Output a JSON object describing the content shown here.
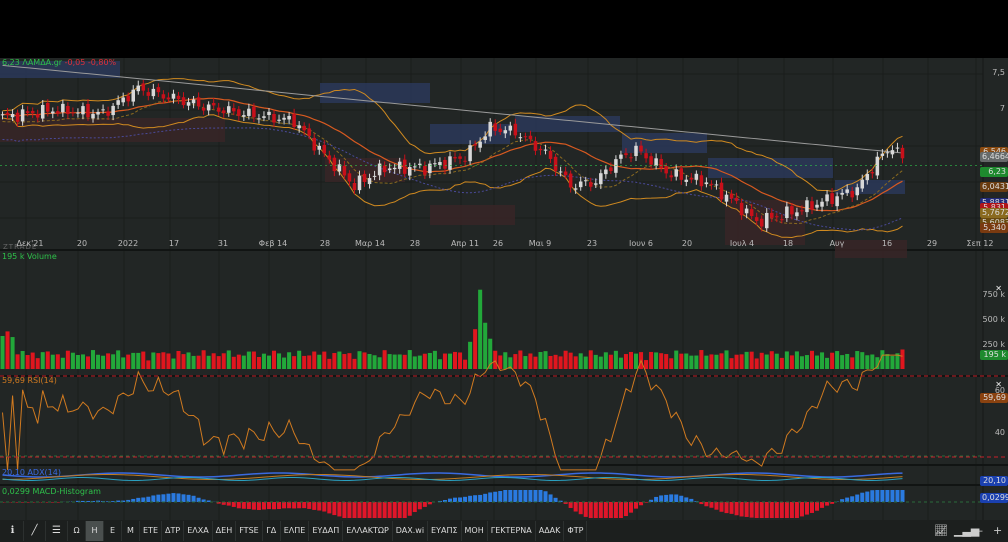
{
  "header": {
    "price": "6,23",
    "symbol": "ΛΑΜΔΑ.gr",
    "change": "-0,05",
    "change_pct": "-0,80%"
  },
  "watermark": "ZTRADE",
  "price_axis": {
    "ticks": [
      "7,5",
      "7"
    ],
    "tags": [
      {
        "value": "6,546",
        "color": "#8a4a10"
      },
      {
        "value": "6,4664",
        "color": "#666a6a"
      },
      {
        "value": "6,23",
        "color": "#1e8a2e"
      },
      {
        "value": "6,0431",
        "color": "#6a3c10"
      },
      {
        "value": "5,8831",
        "color": "#222a7a"
      },
      {
        "value": "5,831",
        "color": "#b0141a"
      },
      {
        "value": "5,7672",
        "color": "#8a6a20"
      },
      {
        "value": "5,6083",
        "color": "#6a4a10"
      },
      {
        "value": "5,340",
        "color": "#7a3a10"
      }
    ]
  },
  "x_axis": [
    "Δεκ'21",
    "20",
    "2022",
    "17",
    "31",
    "Φεβ 14",
    "28",
    "Μαρ 14",
    "28",
    "Απρ 11",
    "26",
    "Μαι 9",
    "23",
    "Ιουν 6",
    "20",
    "Ιουλ 4",
    "18",
    "Αυγ",
    "16",
    "29",
    "Σεπ 12"
  ],
  "volume": {
    "label": "195 k Volume",
    "ticks": [
      "750 k",
      "500 k",
      "250 k"
    ],
    "tag": "195 k"
  },
  "rsi": {
    "label": "59,69 RSI(14)",
    "ticks": [
      "60",
      "40"
    ],
    "tag": "59,69"
  },
  "adx": {
    "label": "20,10 ADX(14)",
    "tag": "20,10"
  },
  "macd": {
    "label": "0,0299 MACD-Histogram",
    "tag": "0,0299"
  },
  "toolbar": {
    "items": [
      "Ω",
      "Η",
      "Ε",
      "Μ",
      "ΕΤΕ",
      "ΔΤΡ",
      "ΕΛΧΑ",
      "ΔΕΗ",
      "FTSE",
      "ΓΔ",
      "ΕΛΠΕ",
      "ΕΥΔΑΠ",
      "ΕΛΛΑΚΤΩΡ",
      "DAX.wi",
      "ΕΥΑΠΣ",
      "ΜΟΗ",
      "ΓΕΚΤΕΡΝΑ",
      "ΑΔΑΚ",
      "ΦΤΡ"
    ],
    "active": "Η"
  },
  "colors": {
    "up": "#d8d8d8",
    "down": "#c8101a",
    "vol_up": "#22a83a",
    "vol_down": "#e0161e",
    "ma": "#d08a20",
    "rsi": "#d07a20"
  },
  "chart_data": {
    "type": "candlestick",
    "ylim": [
      5.2,
      7.7
    ],
    "candles": 180,
    "close_waypoints": [
      [
        0,
        6.9
      ],
      [
        10,
        7.0
      ],
      [
        20,
        6.95
      ],
      [
        27,
        7.3
      ],
      [
        32,
        7.2
      ],
      [
        40,
        7.05
      ],
      [
        48,
        6.95
      ],
      [
        58,
        6.85
      ],
      [
        63,
        6.45
      ],
      [
        70,
        5.95
      ],
      [
        76,
        6.2
      ],
      [
        84,
        6.2
      ],
      [
        92,
        6.35
      ],
      [
        97,
        6.75
      ],
      [
        102,
        6.7
      ],
      [
        108,
        6.4
      ],
      [
        113,
        5.95
      ],
      [
        118,
        6.0
      ],
      [
        122,
        6.3
      ],
      [
        126,
        6.45
      ],
      [
        133,
        6.1
      ],
      [
        140,
        6.0
      ],
      [
        146,
        5.7
      ],
      [
        150,
        5.45
      ],
      [
        158,
        5.6
      ],
      [
        164,
        5.75
      ],
      [
        170,
        5.9
      ],
      [
        174,
        6.3
      ],
      [
        177,
        6.5
      ],
      [
        180,
        6.23
      ]
    ]
  }
}
